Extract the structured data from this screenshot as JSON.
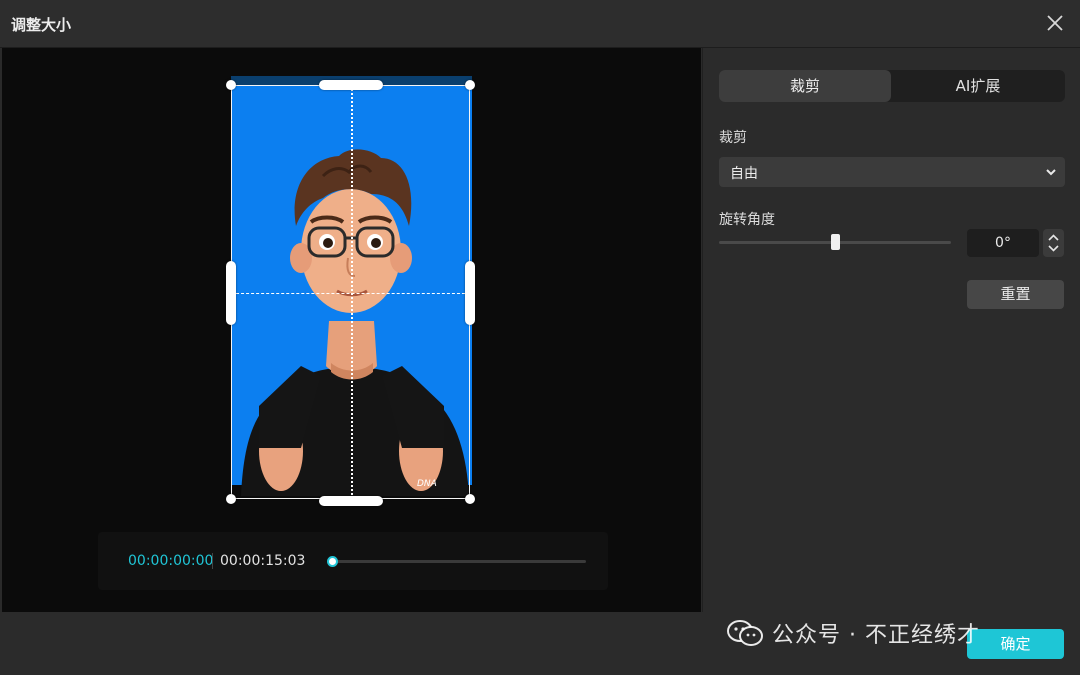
{
  "window": {
    "title": "调整大小"
  },
  "preview": {
    "time_current": "00:00:00:00",
    "time_total": "00:00:15:03",
    "playback_progress": 0.0
  },
  "panel": {
    "tabs": [
      {
        "label": "裁剪",
        "active": true
      },
      {
        "label": "AI扩展",
        "active": false
      }
    ],
    "crop_label": "裁剪",
    "crop_ratio_value": "自由",
    "rotation_label": "旋转角度",
    "rotation_value": "0°",
    "rotation_slider_fraction": 0.5,
    "reset_label": "重置"
  },
  "footer": {
    "confirm_label": "确定"
  },
  "watermark": {
    "text": "公众号 · 不正经绣才"
  },
  "colors": {
    "accent": "#1ec6d6",
    "time_accent": "#20c5d6",
    "video_background": "#0c7ff0",
    "dialog_bg": "#2a2a2a"
  }
}
